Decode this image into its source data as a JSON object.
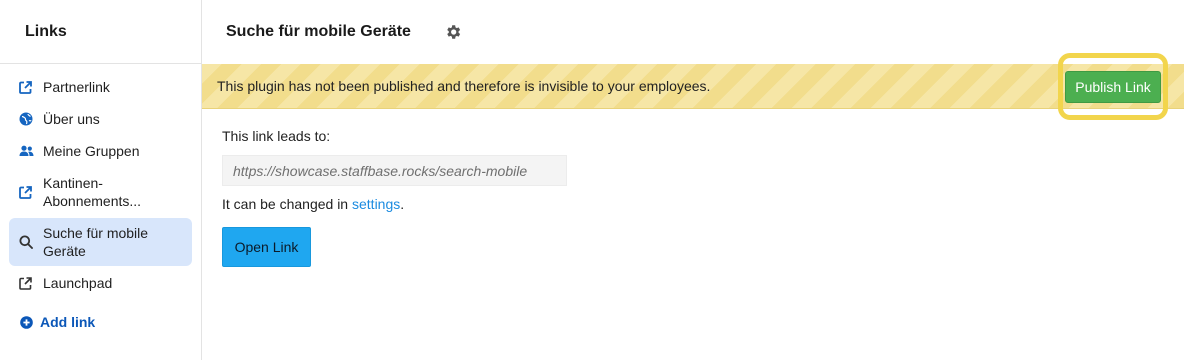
{
  "sidebar": {
    "title": "Links",
    "items": [
      {
        "label": "Partnerlink",
        "icon": "external-link-icon"
      },
      {
        "label": "Über uns",
        "icon": "globe-icon"
      },
      {
        "label": "Meine Gruppen",
        "icon": "users-icon"
      },
      {
        "label": "Kantinen-Abonnements...",
        "icon": "external-link-icon"
      },
      {
        "label": "Suche für mobile Geräte",
        "icon": "search-icon",
        "active": true
      },
      {
        "label": "Launchpad",
        "icon": "external-link-icon"
      }
    ],
    "add_link_label": "Add link"
  },
  "header": {
    "title": "Suche für mobile Geräte",
    "settings_icon": "gear-icon"
  },
  "banner": {
    "message": "This plugin has not been published and therefore is invisible to your employees.",
    "publish_label": "Publish Link"
  },
  "content": {
    "leads_label": "This link leads to:",
    "url": "https://showcase.staffbase.rocks/search-mobile",
    "changed_prefix": "It can be changed in",
    "settings_link": "settings",
    "changed_suffix": ".",
    "open_label": "Open Link"
  },
  "colors": {
    "accent_blue": "#1fa7f0",
    "publish_green": "#4caf50",
    "highlight_yellow": "#f2d54c",
    "active_item_bg": "#d8e6fb",
    "link_blue": "#0b57b8"
  }
}
